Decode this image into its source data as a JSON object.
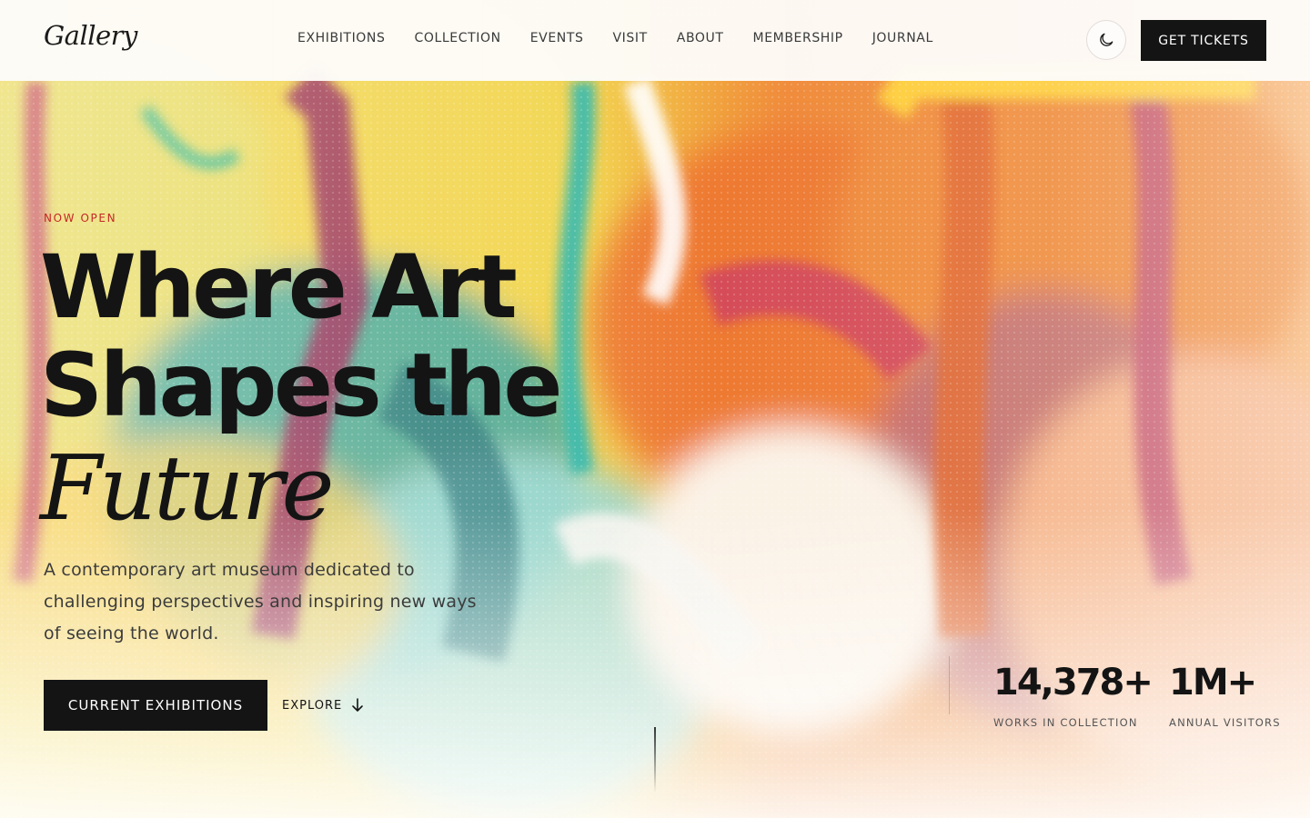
{
  "header": {
    "logo": "Gallery",
    "nav": [
      {
        "label": "EXHIBITIONS"
      },
      {
        "label": "COLLECTION"
      },
      {
        "label": "EVENTS"
      },
      {
        "label": "VISIT"
      },
      {
        "label": "ABOUT"
      },
      {
        "label": "MEMBERSHIP"
      },
      {
        "label": "JOURNAL"
      }
    ],
    "theme_toggle_icon": "moon-icon",
    "tickets_label": "GET TICKETS"
  },
  "hero": {
    "eyebrow": "NOW OPEN",
    "headline_line1": "Where Art",
    "headline_line2": "Shapes the",
    "headline_line3": "Future",
    "intro": "A contemporary art museum dedicated to challenging perspectives and inspiring new ways of seeing the world.",
    "primary_cta": "CURRENT EXHIBITIONS",
    "secondary_cta": "EXPLORE",
    "secondary_cta_icon": "arrow-down-icon",
    "background_image": "abstract-paint-texture"
  },
  "stats": [
    {
      "value": "14,378+",
      "label": "WORKS IN COLLECTION"
    },
    {
      "value": "1M+",
      "label": "ANNUAL VISITORS"
    }
  ],
  "colors": {
    "accent_red": "#c42727",
    "ink": "#141414",
    "header_bg": "#fdfcfa"
  }
}
